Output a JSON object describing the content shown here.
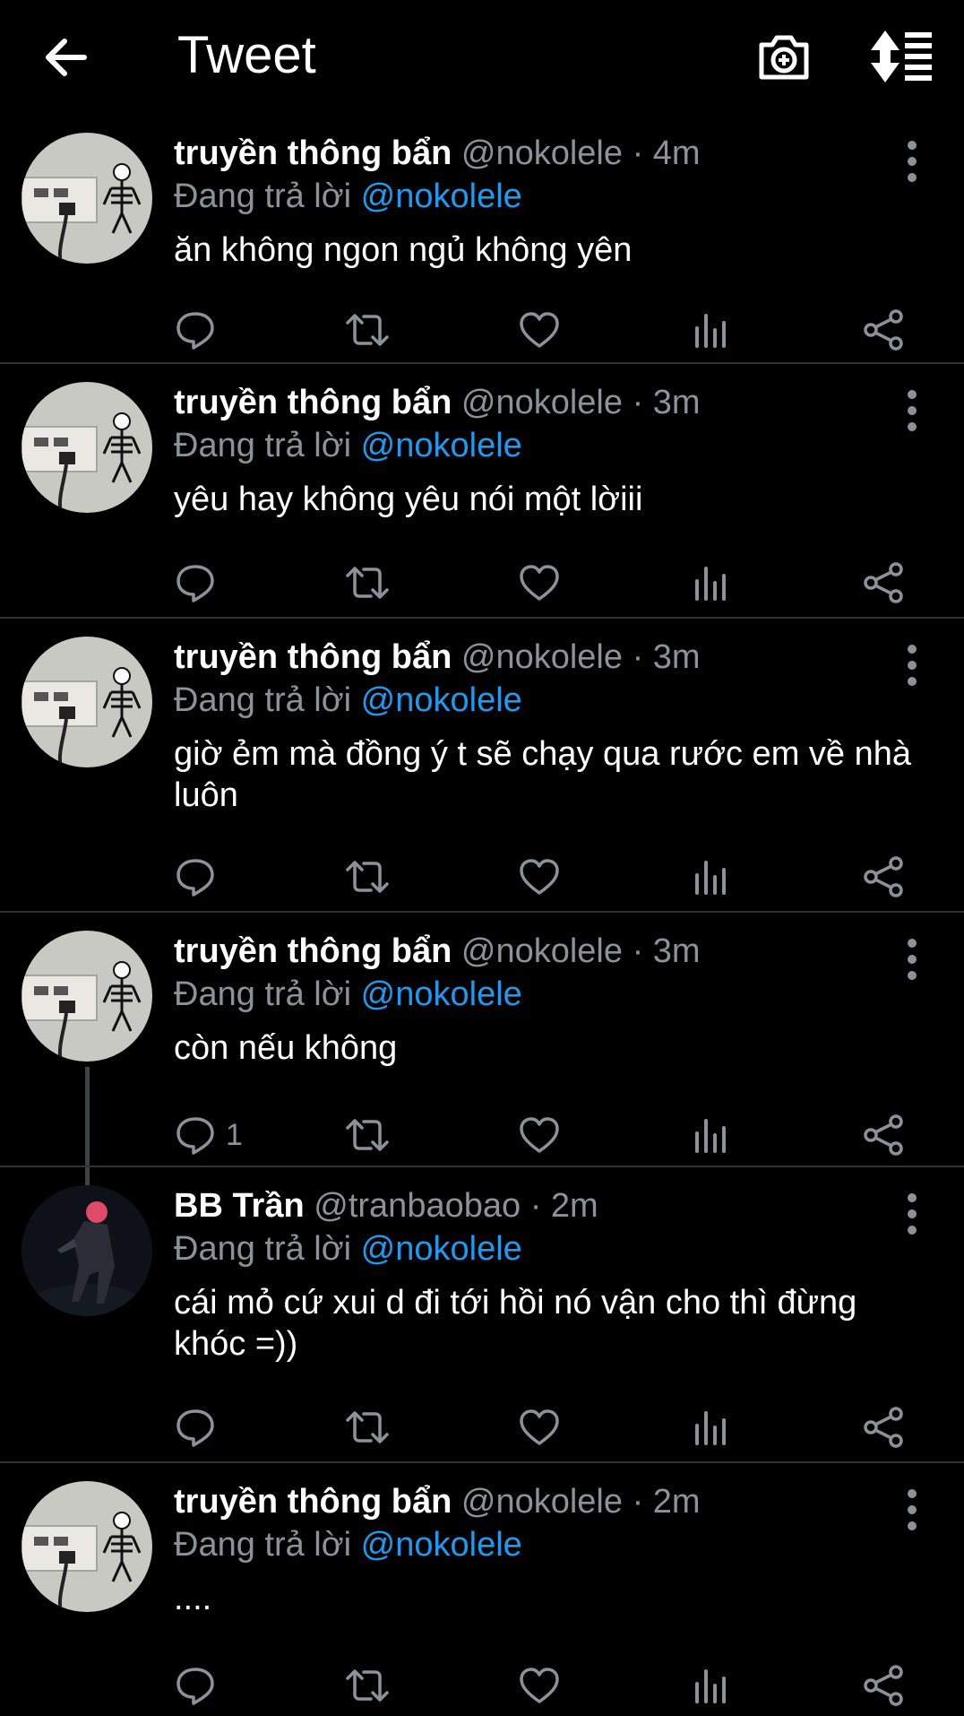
{
  "header": {
    "title": "Tweet",
    "back_icon": "arrow-left-icon",
    "camera_icon": "camera-plus-icon",
    "sort_icon": "sort-icon"
  },
  "tweets": [
    {
      "name": "truyền thông bẩn",
      "handle": "@nokolele",
      "time": "4m",
      "reply_prefix": "Đang trả lời",
      "reply_to": "@nokolele",
      "text": "ăn không ngon ngủ không yên",
      "reply_count": ""
    },
    {
      "name": "truyền thông bẩn",
      "handle": "@nokolele",
      "time": "3m",
      "reply_prefix": "Đang trả lời",
      "reply_to": "@nokolele",
      "text": "yêu hay không yêu nói một lờiii",
      "reply_count": ""
    },
    {
      "name": "truyền thông bẩn",
      "handle": "@nokolele",
      "time": "3m",
      "reply_prefix": "Đang trả lời",
      "reply_to": "@nokolele",
      "text": "giờ ẻm mà đồng ý t sẽ chạy qua rước em về nhà luôn",
      "reply_count": ""
    },
    {
      "name": "truyền thông bẩn",
      "handle": "@nokolele",
      "time": "3m",
      "reply_prefix": "Đang trả lời",
      "reply_to": "@nokolele",
      "text": "còn nếu không",
      "reply_count": "1"
    },
    {
      "name": "BB Trần",
      "handle": "@tranbaobao",
      "time": "2m",
      "reply_prefix": "Đang trả lời",
      "reply_to": "@nokolele",
      "text": "cái mỏ cứ xui d đi tới hồi nó vận cho thì đừng khóc =))",
      "reply_count": ""
    },
    {
      "name": "truyền thông bẩn",
      "handle": "@nokolele",
      "time": "2m",
      "reply_prefix": "Đang trả lời",
      "reply_to": "@nokolele",
      "text": "....",
      "reply_count": ""
    }
  ],
  "separator": "·",
  "colors": {
    "background": "#000000",
    "accent": "#1d9bf0",
    "secondary_text": "#8b9299",
    "divider": "#2f3336"
  }
}
